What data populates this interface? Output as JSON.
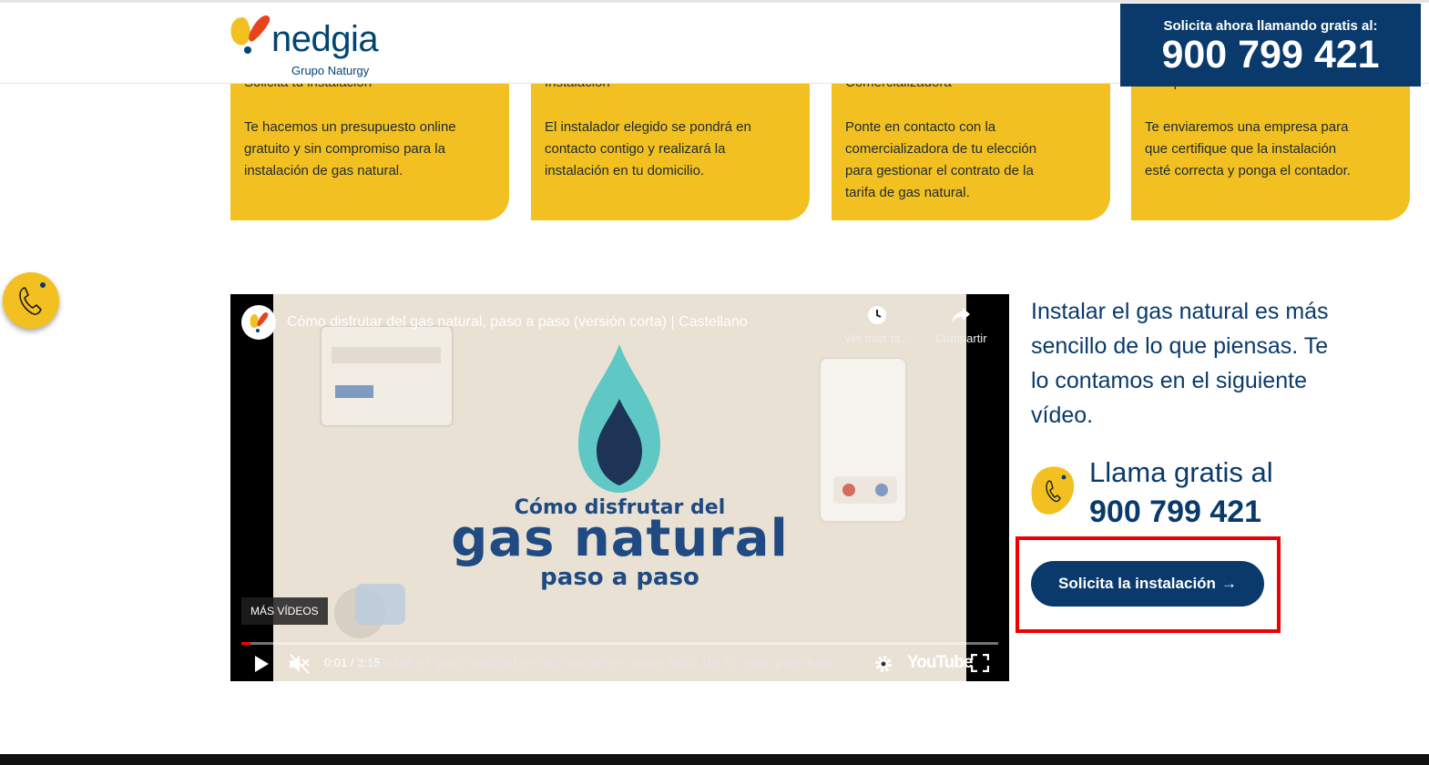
{
  "header": {
    "logo_name": "nedgia",
    "logo_sub": "Grupo Naturgy",
    "call_label": "Solicita ahora llamando gratis al:",
    "call_number": "900 799 421"
  },
  "steps": [
    {
      "title": "Solicita tu instalación",
      "text": "Te hacemos un presupuesto online gratuito y sin compromiso para la instalación de gas natural."
    },
    {
      "title": "Instalación",
      "text": "El instalador elegido se pondrá en contacto contigo y realizará la instalación en tu domicilio."
    },
    {
      "title": "Comercializadora",
      "text": "Ponte en contacto con la comercializadora de tu elección para gestionar el contrato de la tarifa de gas natural."
    },
    {
      "title": "Comprobación",
      "text": "Te enviaremos una empresa para que certifique que la instalación esté correcta y ponga el contador."
    }
  ],
  "video": {
    "title": "Cómo disfrutar del gas natural, paso a paso (versión corta) | Castellano",
    "watch_later": "Ver más ta...",
    "share": "Compartir",
    "headline_top": "Cómo disfrutar del",
    "headline_main": "gas natural",
    "headline_bottom": "paso a paso",
    "more_videos": "MÁS VÍDEOS",
    "time": "0:01 / 2:15",
    "progress": 0.008,
    "subtitle": "Instalar el gas natural en tu hogar es más fácil de lo que piensas",
    "youtube": "YouTube"
  },
  "right": {
    "intro": "Instalar el gas natural es más sencillo de lo que piensas. Te lo contamos en el siguiente vídeo.",
    "call_label": "Llama gratis al",
    "call_number": "900 799 421",
    "cta_label": "Solicita la instalación",
    "cta_arrow": "→"
  },
  "colors": {
    "brand_navy": "#0a3a6b",
    "brand_yellow": "#f2c021",
    "highlight": "#f00000"
  }
}
